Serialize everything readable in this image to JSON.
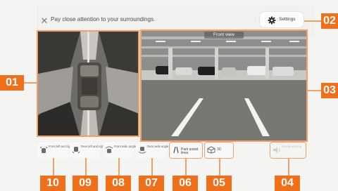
{
  "notice": {
    "text": "Pay close attention to your surroundings.",
    "close_icon": "close-icon"
  },
  "settings": {
    "label": "Settings",
    "icon": "gear-icon"
  },
  "front_view": {
    "title": "Front view"
  },
  "buttons": [
    {
      "label": "Front left and right",
      "icon": "car-front-corners-icon"
    },
    {
      "label": "Rear left and right",
      "icon": "car-rear-corners-icon"
    },
    {
      "label": "Front wide angle",
      "icon": "car-front-wide-icon"
    },
    {
      "label": "Rear wide angle",
      "icon": "car-rear-wide-icon"
    },
    {
      "label": "Park assist lines",
      "icon": "parking-lines-icon"
    },
    {
      "label": "3D",
      "icon": "3d-view-icon"
    },
    {
      "label": "Sound warning",
      "icon": "speaker-icon"
    }
  ],
  "callouts": [
    "01",
    "02",
    "03",
    "04",
    "05",
    "06",
    "07",
    "08",
    "09",
    "10"
  ],
  "colors": {
    "accent": "#f06f1a",
    "outline": "#f2a067",
    "background": "#f4f4f2"
  }
}
